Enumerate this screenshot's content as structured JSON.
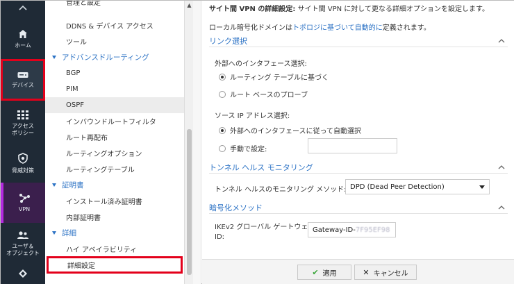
{
  "rail": {
    "home": "ホーム",
    "devices": "デバイス",
    "access_policy_1": "アクセス",
    "access_policy_2": "ポリシー",
    "threat": "脅威対策",
    "vpn": "VPN",
    "users_1": "ユーザ＆",
    "users_2": "オブジェクト"
  },
  "subnav": {
    "clipped_item": "管理と設定",
    "ddns": "DDNS & デバイス アクセス",
    "tools": "ツール",
    "group_routing": "アドバンスドルーティング",
    "bgp": "BGP",
    "pim": "PIM",
    "ospf": "OSPF",
    "inbound_filter": "インバウンドルートフィルタ",
    "redistribution": "ルート再配布",
    "routing_options": "ルーティングオプション",
    "routing_table": "ルーティングテーブル",
    "group_certs": "証明書",
    "installed_certs": "インストール済み証明書",
    "internal_certs": "内部証明書",
    "group_advanced": "詳細",
    "ha": "ハイ アベイラビリティ",
    "advanced_settings": "詳細設定"
  },
  "main": {
    "desc_bold": "サイト間 VPN の詳細設定:",
    "desc_rest": " サイト間 VPN に対して更なる詳細オプションを設定します。",
    "sub_pre": "ローカル暗号化ドメインは",
    "sub_link": "トポロジに基づいて自動的に",
    "sub_post": "定義されます。",
    "link_section": "リンク選択",
    "external_if_label": "外部へのインタフェース選択:",
    "radio_routing_table": "ルーティング テーブルに基づく",
    "radio_route_probe": "ルート ベースのプローブ",
    "source_ip_label": "ソース IP アドレス選択:",
    "radio_auto": "外部へのインタフェースに従って自動選択",
    "radio_manual": "手動で設定:",
    "manual_value": "",
    "tunnel_section": "トンネル ヘルス モニタリング",
    "tunnel_method_label": "トンネル ヘルスのモニタリング メソッド:",
    "tunnel_method_value": "DPD (Dead Peer Detection)",
    "crypto_section": "暗号化メソッド",
    "ikev2_label_1": "IKEv2 グローバル ゲートウェイ",
    "ikev2_label_2": "ID:",
    "ikev2_value_prefix": "Gateway-ID-",
    "ikev2_value_masked": "7F95EF98",
    "apply": "適用",
    "cancel": "キャンセル"
  }
}
